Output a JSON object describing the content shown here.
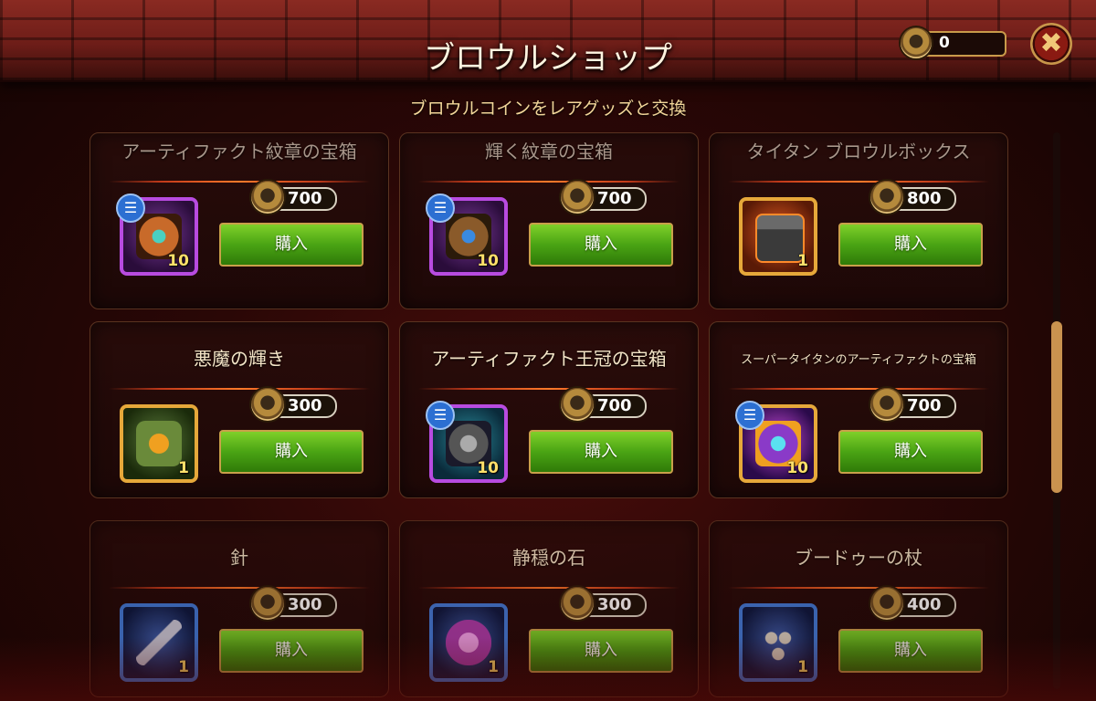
{
  "header": {
    "title": "ブロウルショップ",
    "subtitle": "ブロウルコインをレアグッズと交換"
  },
  "currency": {
    "icon": "brawl-coin-icon",
    "value": "0"
  },
  "close_icon": "✖",
  "buy_label": "購入",
  "cards": [
    {
      "name": "アーティファクト紋章の宝箱",
      "price": "700",
      "qty": "10",
      "frame": "purple",
      "info": true
    },
    {
      "name": "輝く紋章の宝箱",
      "price": "700",
      "qty": "10",
      "frame": "purple",
      "info": true
    },
    {
      "name": "タイタン ブロウルボックス",
      "price": "800",
      "qty": "1",
      "frame": "gold",
      "info": false
    },
    {
      "name": "悪魔の輝き",
      "price": "300",
      "qty": "1",
      "frame": "gold",
      "info": false
    },
    {
      "name": "アーティファクト王冠の宝箱",
      "price": "700",
      "qty": "10",
      "frame": "purple",
      "info": true
    },
    {
      "name": "スーパータイタンのアーティファクトの宝箱",
      "price": "700",
      "qty": "10",
      "frame": "gold",
      "info": true
    },
    {
      "name": "針",
      "price": "300",
      "qty": "1",
      "frame": "blue",
      "info": false
    },
    {
      "name": "静穏の石",
      "price": "300",
      "qty": "1",
      "frame": "blue",
      "info": false
    },
    {
      "name": "ブードゥーの杖",
      "price": "400",
      "qty": "1",
      "frame": "blue",
      "info": false
    }
  ]
}
